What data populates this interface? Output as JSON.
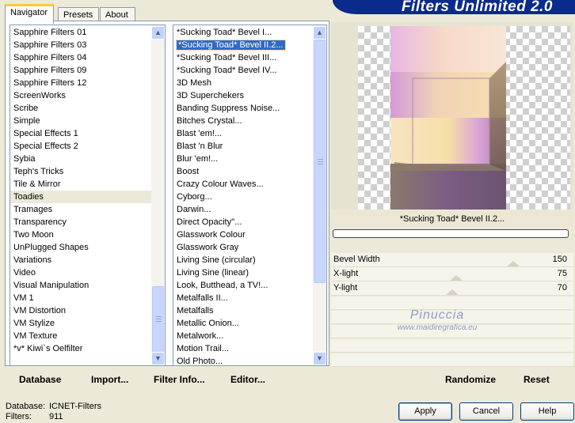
{
  "banner": {
    "title": "Filters Unlimited 2.0"
  },
  "tabs": [
    {
      "label": "Navigator"
    },
    {
      "label": "Presets"
    },
    {
      "label": "About"
    }
  ],
  "categories": [
    "Sapphire Filters 01",
    "Sapphire Filters 03",
    "Sapphire Filters 04",
    "Sapphire Filters 09",
    "Sapphire Filters 12",
    "ScreenWorks",
    "Scribe",
    "Simple",
    "Special Effects 1",
    "Special Effects 2",
    "Sybia",
    "Teph's Tricks",
    "Tile & Mirror",
    "Toadies",
    "Tramages",
    "Transparency",
    "Two Moon",
    "UnPlugged Shapes",
    "Variations",
    "Video",
    "Visual Manipulation",
    "VM 1",
    "VM Distortion",
    "VM Stylize",
    "VM Texture",
    "*v* Kiwi`s Oelfilter"
  ],
  "categories_highlighted_index": 13,
  "filters": [
    "*Sucking Toad*  Bevel I...",
    "*Sucking Toad*  Bevel II.2...",
    "*Sucking Toad*  Bevel III...",
    "*Sucking Toad*  Bevel IV...",
    "3D Mesh",
    "3D Superchekers",
    "Banding Suppress Noise...",
    "Bitches Crystal...",
    "Blast 'em!...",
    "Blast 'n Blur",
    "Blur 'em!...",
    "Boost",
    "Crazy Colour Waves...",
    "Cyborg...",
    "Darwin...",
    "Direct Opacity''...",
    "Glasswork Colour",
    "Glasswork Gray",
    "Living Sine (circular)",
    "Living Sine (linear)",
    "Look, Butthead, a TV!...",
    "Metalfalls II...",
    "Metalfalls",
    "Metallic Onion...",
    "Metalwork...",
    "Motion Trail...",
    "Old Photo..."
  ],
  "filters_selected_index": 1,
  "left_buttons": {
    "database": "Database",
    "import": "Import...",
    "filter_info": "Filter Info...",
    "editor": "Editor..."
  },
  "preview": {
    "filter_name": "*Sucking Toad*  Bevel II.2..."
  },
  "params": [
    {
      "name": "Bevel Width",
      "value": "150",
      "level": 0.59
    },
    {
      "name": "X-light",
      "value": "75",
      "level": 0.29
    },
    {
      "name": "Y-light",
      "value": "70",
      "level": 0.27
    }
  ],
  "right_buttons": {
    "randomize": "Randomize",
    "reset": "Reset"
  },
  "watermark": {
    "line1": "Pinuccia",
    "line2": "www.maidiregrafica.eu"
  },
  "status": {
    "database_label": "Database:",
    "database_value": "ICNET-Filters",
    "filters_label": "Filters:",
    "filters_value": "911"
  },
  "dialog_buttons": {
    "apply": "Apply",
    "cancel": "Cancel",
    "help": "Help"
  },
  "colors": {
    "banner": "#0a2a8c",
    "selection": "#316ac5",
    "accent_tab": "#ffc83c"
  }
}
